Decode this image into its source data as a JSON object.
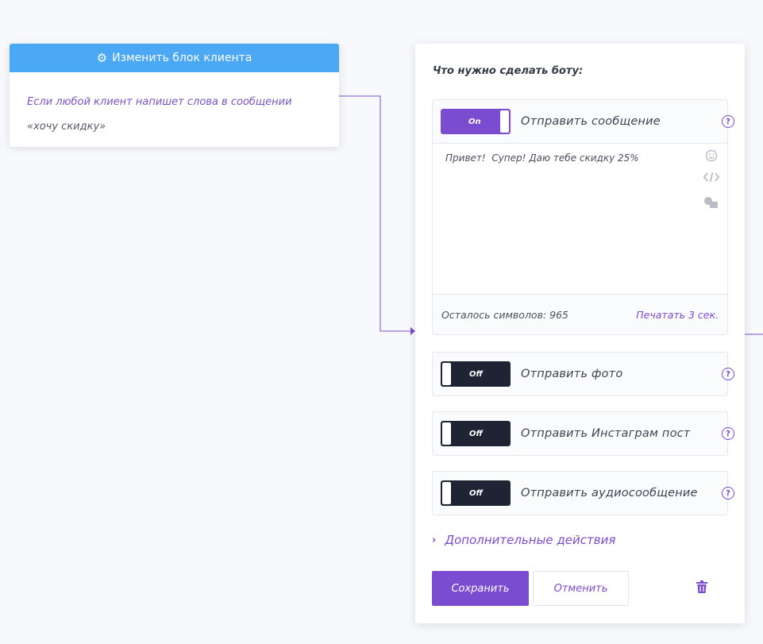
{
  "client_block": {
    "header_label": "Изменить блок клиента",
    "condition_text": "Если любой клиент напишет слова в сообщении",
    "keyword_text": "«хочу скидку»"
  },
  "panel": {
    "title": "Что нужно сделать боту:",
    "actions": [
      {
        "toggle_label": "On",
        "label": "Отправить сообщение",
        "help": "?",
        "message_text": "Привет!  Супер! Даю тебе скидку 25%",
        "remaining_label": "Осталось символов: 965",
        "typing_label": "Печатать 3 сек."
      },
      {
        "toggle_label": "Off",
        "label": "Отправить фото",
        "help": "?"
      },
      {
        "toggle_label": "Off",
        "label": "Отправить Инстаграм пост",
        "help": "?"
      },
      {
        "toggle_label": "Off",
        "label": "Отправить аудиосообщение",
        "help": "?"
      }
    ],
    "editor_icons": [
      "emoji-icon",
      "code-icon",
      "image-icon"
    ],
    "more_actions": "Дополнительные действия",
    "save_label": "Сохранить",
    "cancel_label": "Отменить"
  },
  "colors": {
    "accent": "#7b4bd0",
    "header_blue": "#4aa8f5",
    "toggle_off": "#1f2434"
  }
}
